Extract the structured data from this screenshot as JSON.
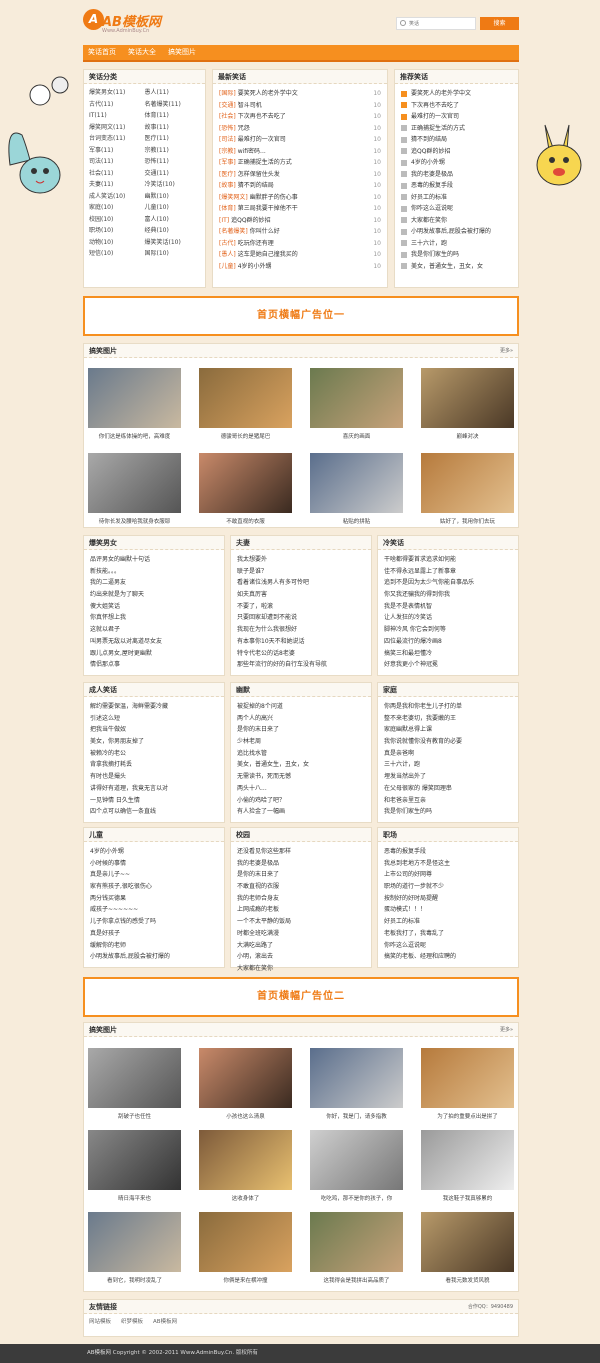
{
  "header": {
    "logo_mark": "A",
    "logo_text": "AB模板网",
    "logo_sub": "Www.AdminBuy.Cn",
    "search_placeholder": "笑话",
    "search_button": "搜索"
  },
  "nav": [
    "笑话首页",
    "笑话大全",
    "搞笑图片"
  ],
  "categories": {
    "title": "笑话分类",
    "items": [
      "爆笑男女(11)",
      "愚人(11)",
      "古代(11)",
      "名著爆笑(11)",
      "IT(11)",
      "体育(11)",
      "爆笑网文(11)",
      "故事(11)",
      "台词变态(11)",
      "医疗(11)",
      "军事(11)",
      "宗教(11)",
      "司法(11)",
      "恐怖(11)",
      "社会(11)",
      "交通(11)",
      "夫妻(11)",
      "冷笑话(10)",
      "成人笑话(10)",
      "幽默(10)",
      "家庭(10)",
      "儿童(10)",
      "校园(10)",
      "富人(10)",
      "职场(10)",
      "经典(10)",
      "动物(10)",
      "爆笑笑话(10)",
      "短信(10)",
      "国际(10)"
    ]
  },
  "latest": {
    "title": "最新笑话",
    "items": [
      {
        "tag": "[国际]",
        "text": "要笑死人的老外学中文",
        "num": "10"
      },
      {
        "tag": "[交通]",
        "text": "智斗司机",
        "num": "10"
      },
      {
        "tag": "[社会]",
        "text": "下次再也不去吃了",
        "num": "10"
      },
      {
        "tag": "[恐怖]",
        "text": "咒怨",
        "num": "10"
      },
      {
        "tag": "[司法]",
        "text": "最难打的一次官司",
        "num": "10"
      },
      {
        "tag": "[宗教]",
        "text": "wifi密码...",
        "num": "10"
      },
      {
        "tag": "[军事]",
        "text": "正确捕捉生活的方式",
        "num": "10"
      },
      {
        "tag": "[医疗]",
        "text": "怎样保留住头发",
        "num": "10"
      },
      {
        "tag": "[故事]",
        "text": "猜不到的结局",
        "num": "10"
      },
      {
        "tag": "[爆笑网文]",
        "text": "幽默胖子的伤心事",
        "num": "10"
      },
      {
        "tag": "[体育]",
        "text": "第三局我要干掉他不干",
        "num": "10"
      },
      {
        "tag": "[IT]",
        "text": "追QQ群的妙招",
        "num": "10"
      },
      {
        "tag": "[名著爆笑]",
        "text": "你叫什么好",
        "num": "10"
      },
      {
        "tag": "[古代]",
        "text": "吃玩你还有理",
        "num": "10"
      },
      {
        "tag": "[愚人]",
        "text": "这车是她自己撞我买的",
        "num": "10"
      },
      {
        "tag": "[儿童]",
        "text": "4岁的小外甥",
        "num": "10"
      }
    ]
  },
  "recommended": {
    "title": "推荐笑话",
    "items": [
      "要笑死人的老外学中文",
      "下次再也不去吃了",
      "最难打的一次官司",
      "正确捕捉生活的方式",
      "猜不到的结局",
      "追QQ群的妙招",
      "4岁的小外甥",
      "我的老婆是极品",
      "恶毒的报复手段",
      "好员工的标准",
      "你咋这么逗说呢",
      "大家都在笑你",
      "小明发故事后,屁股会被打爆的",
      "三十六计，跑",
      "我是你们家生的吗",
      "美女，普通女生，丑女，女"
    ]
  },
  "banner1": "首页横幅广告位一",
  "banner2": "首页横幅广告位二",
  "photos1": {
    "title": "搞笑图片",
    "more": "更多»",
    "items": [
      "你们这是练体操的吧，高难度",
      "德骏哥长的是猪尾巴",
      "喜庆的画面",
      "巅峰对决",
      "待你长发及腰哈我就身衣服耶",
      "不敢直视的衣服",
      "粘贴的拼贴",
      "姑好了，我用你们去玩"
    ]
  },
  "sections": [
    {
      "title": "爆笑男女",
      "items": [
        "品评男女的幽默十句话",
        "新技能。。。",
        "我的二逼男友",
        "约出来就是为了聊天",
        "傻大姐笑话",
        "你真怀想上我",
        "这就以君子",
        "叫男票无敌以对离道尽女友",
        "跟儿点男女,屋时更幽默",
        "情侣那点事"
      ]
    },
    {
      "title": "夫妻",
      "items": [
        "我太想要外",
        "联子是谁？",
        "看着诸位浅男人有多可怜吧",
        "如夫真厉害",
        "不要了，啦滚",
        "只要回家却遭到不能说",
        "我现在为什么我很想好",
        "有本事你10天不和她说话",
        "特令代老公的话8老婆",
        "那些年流行的好的自行车没有导航"
      ]
    },
    {
      "title": "冷笑话",
      "items": [
        "干啥都得要首求追求如何能",
        "佳不得永远显露上了新事章",
        "追到不是因为太少气你能自事品乐",
        "你又我还骗我的得到你我",
        "我是不是表情机智",
        "让人发狂的冷笑话",
        "脚神冷风 你它会到何等",
        "四位最流行的爆冷画8",
        "搞笑三和最坦懂冷",
        "好意我更小个神冠冕"
      ]
    },
    {
      "title": "成人笑话",
      "items": [
        "解约需要保温，海鲜需要冷藏",
        "引述这么短",
        "把我当牛做奴",
        "美女，你男朋友掉了",
        "被赖冷的老公",
        "背拿我摘打耗丢",
        "有时也是撮头",
        "讲得好有道理，我竟无言以对",
        "一见钟情 日久生情",
        "四个点可以确信一条直线"
      ]
    },
    {
      "title": "幽默",
      "items": [
        "被捉掉的8个问道",
        "两个人的高兴",
        "是你的末日来了",
        "少林老周",
        "追比找水管",
        "美女，普通女生，丑女，女",
        "无需读书，死而无憾",
        "两头十八...",
        "小偷的鸡哈了吧？",
        "有人捡金了一幅画"
      ]
    },
    {
      "title": "家庭",
      "items": [
        "你两是我和你老生儿子打的单",
        "整不来老婆切，我要嫩的王",
        "家庭幽默总得上课",
        "我你说就懂你没有教育的必要",
        "真是亲爸啊",
        "三十六计，跑",
        "埋发当然出外了",
        "在父母很家的 爆笑回理串",
        "和老爸亲里互亲",
        "我是你们家生的吗"
      ]
    },
    {
      "title": "儿童",
      "items": [
        "4岁的小外甥",
        "小时候的事情",
        "真是亲儿子~~",
        "家有熊孩子,很吃很伤心",
        "两分钱买德果",
        "威孩子~~~~~~",
        "儿子你拿点钱的感受了吗",
        "真是好孩子",
        "缓解你的老师",
        "小明发故事后,屁股会被打爆的"
      ]
    },
    {
      "title": "校园",
      "items": [
        "还没看见你这些那样",
        "我的老婆是极品",
        "是你的末日来了",
        "不敢直视的衣服",
        "我的老师合身友",
        "上网成瘾的老板",
        "一个不太平静的饭局",
        "时都全班吃满漫",
        "大满吃出路了",
        "小明，滚出去",
        "大家都在笑你"
      ]
    },
    {
      "title": "职场",
      "items": [
        "恶毒的报复手段",
        "我总到老地方不是怪这主",
        "上市公司的好网尊",
        "职场的道行一步就不少",
        "按制好的好时局提醒",
        "蛋动模式！！！",
        "好员工的标准",
        "老板我打了，我毒乱了",
        "你咋这么逗说呢",
        "搞笑的老板、经理和应聘的"
      ]
    }
  ],
  "photos2": {
    "title": "搞笑图片",
    "more": "更多»",
    "items": [
      "刮破子也任性",
      "小孩也这么清泉",
      "你好，我是门，请多指教",
      "为了拍的重要点出是拼了",
      "晴日海平来也",
      "这收身体了",
      "吃吃鸡，那不是你的孩子，你",
      "我这鞋子我真够累的",
      "看到它，我明时凌乱了",
      "你俩是来在横冲撞",
      "这我得会是我拼出高品质了",
      "看我元数发货风貌"
    ]
  },
  "friends": {
    "title": "友情链接",
    "contact": "合作QQ：9490489",
    "items": [
      "网站模板",
      "织梦模板",
      "AB模板网"
    ]
  },
  "footer": "AB模板网 Copyright © 2002-2011 Www.AdminBuy.Cn. 版权所有"
}
